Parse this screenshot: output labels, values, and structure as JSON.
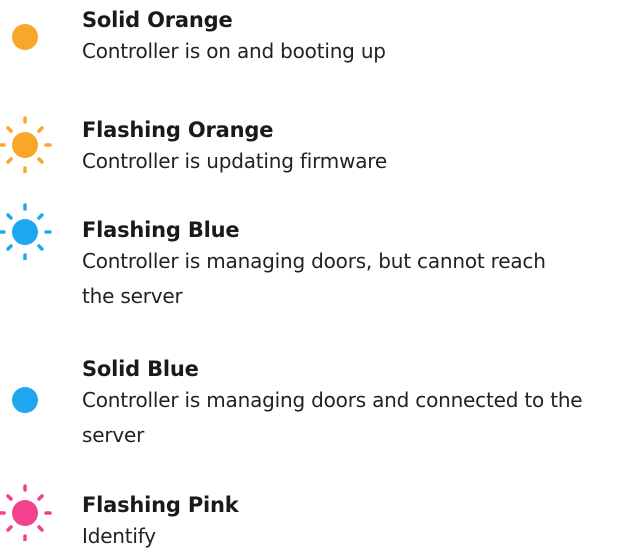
{
  "colors": {
    "orange": "#f9a72b",
    "blue": "#1fa8f0",
    "pink": "#f2428f"
  },
  "legend": [
    {
      "icon": "solid-orange-led-icon",
      "color": "#f9a72b",
      "flashing": false,
      "title": "Solid Orange",
      "description": "Controller is on and booting up"
    },
    {
      "icon": "flashing-orange-led-icon",
      "color": "#f9a72b",
      "flashing": true,
      "title": "Flashing Orange",
      "description": "Controller is updating firmware"
    },
    {
      "icon": "flashing-blue-led-icon",
      "color": "#1fa8f0",
      "flashing": true,
      "title": "Flashing Blue",
      "description": "Controller is managing doors, but cannot reach the server"
    },
    {
      "icon": "solid-blue-led-icon",
      "color": "#1fa8f0",
      "flashing": false,
      "title": "Solid Blue",
      "description": "Controller is managing doors and connected to the server"
    },
    {
      "icon": "flashing-pink-led-icon",
      "color": "#f2428f",
      "flashing": true,
      "title": "Flashing Pink",
      "description": "Identify"
    }
  ]
}
